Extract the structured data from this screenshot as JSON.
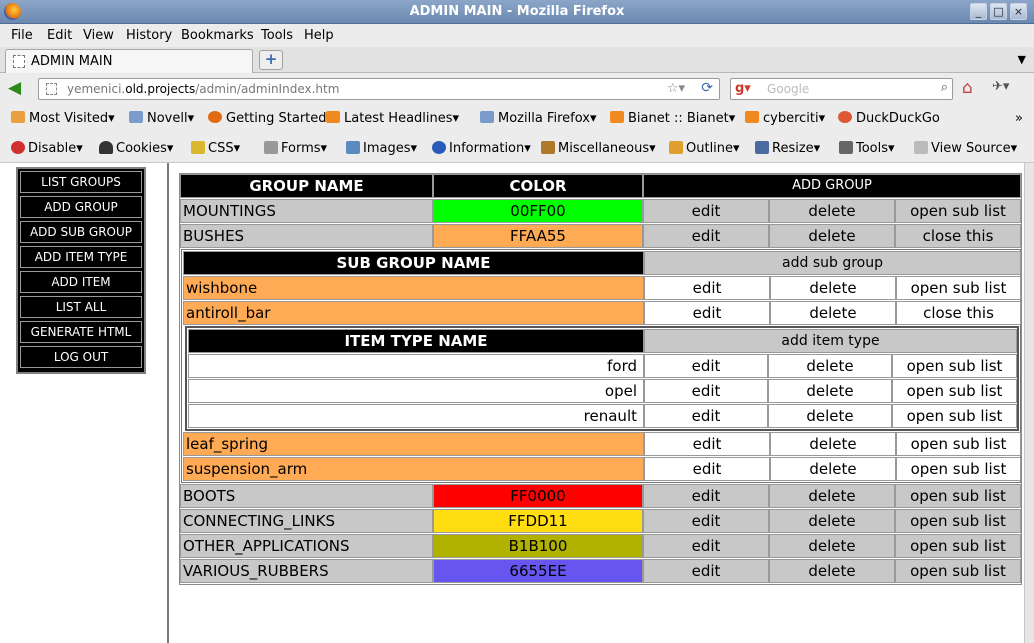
{
  "window": {
    "title": "ADMIN MAIN - Mozilla Firefox"
  },
  "menu": [
    "File",
    "Edit",
    "View",
    "History",
    "Bookmarks",
    "Tools",
    "Help"
  ],
  "tab": {
    "title": "ADMIN MAIN"
  },
  "url": {
    "prefix": "yemenici.",
    "domain": "old.projects",
    "path": "/admin/adminIndex.htm"
  },
  "search": {
    "placeholder": "Google"
  },
  "bookmarks": [
    "Most Visited",
    "Novell",
    "Getting Started",
    "Latest Headlines",
    "Mozilla Firefox",
    "Bianet :: Bianet",
    "cyberciti",
    "DuckDuckGo"
  ],
  "devtools": [
    "Disable",
    "Cookies",
    "CSS",
    "Forms",
    "Images",
    "Information",
    "Miscellaneous",
    "Outline",
    "Resize",
    "Tools",
    "View Source"
  ],
  "sidebar": [
    "LIST GROUPS",
    "ADD GROUP",
    "ADD SUB GROUP",
    "ADD ITEM TYPE",
    "ADD ITEM",
    "LIST ALL",
    "GENERATE HTML",
    "LOG OUT"
  ],
  "table": {
    "headers": {
      "name": "GROUP NAME",
      "color": "COLOR",
      "add": "ADD GROUP"
    },
    "actions": {
      "edit": "edit",
      "delete": "delete",
      "open": "open sub list",
      "close": "close this"
    },
    "groups": [
      {
        "name": "MOUNTINGS",
        "color": "00FF00",
        "hex": "#00ff00"
      },
      {
        "name": "BUSHES",
        "color": "FFAA55",
        "hex": "#ffaa55"
      },
      {
        "name": "BOOTS",
        "color": "FF0000",
        "hex": "#ff0000"
      },
      {
        "name": "CONNECTING_LINKS",
        "color": "FFDD11",
        "hex": "#ffdd11"
      },
      {
        "name": "OTHER_APPLICATIONS",
        "color": "B1B100",
        "hex": "#b1b100"
      },
      {
        "name": "VARIOUS_RUBBERS",
        "color": "6655EE",
        "hex": "#6655ee"
      }
    ],
    "subgroup": {
      "header": "SUB GROUP NAME",
      "add": "add sub group",
      "items": [
        "wishbone",
        "antiroll_bar",
        "leaf_spring",
        "suspension_arm"
      ]
    },
    "itemtype": {
      "header": "ITEM TYPE NAME",
      "add": "add item type",
      "items": [
        "ford",
        "opel",
        "renault"
      ]
    }
  }
}
